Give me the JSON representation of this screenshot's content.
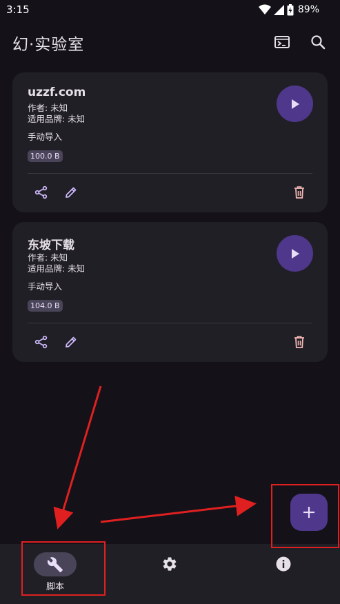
{
  "status_bar": {
    "time": "3:15",
    "battery": "89%"
  },
  "app_bar": {
    "title": "幻·实验室",
    "terminal_icon": "terminal-icon",
    "search_icon": "search-icon"
  },
  "scripts": [
    {
      "title": "uzzf.com",
      "author": "作者: 未知",
      "brand": "适用品牌: 未知",
      "source": "手动导入",
      "size": "100.0 B"
    },
    {
      "title": "东坡下载",
      "author": "作者: 未知",
      "brand": "适用品牌: 未知",
      "source": "手动导入",
      "size": "104.0 B"
    }
  ],
  "fab": {
    "icon": "plus-icon"
  },
  "bottom_nav": [
    {
      "label": "脚本",
      "icon": "wrench-icon",
      "selected": true
    },
    {
      "label": "",
      "icon": "gear-icon",
      "selected": false
    },
    {
      "label": "",
      "icon": "info-icon",
      "selected": false
    }
  ],
  "colors": {
    "background": "#141218",
    "card": "#211f26",
    "accent": "#4f378b",
    "icon_tint": "#d0bcff",
    "delete_tint": "#f2b8b5",
    "annotation": "#e02020"
  }
}
